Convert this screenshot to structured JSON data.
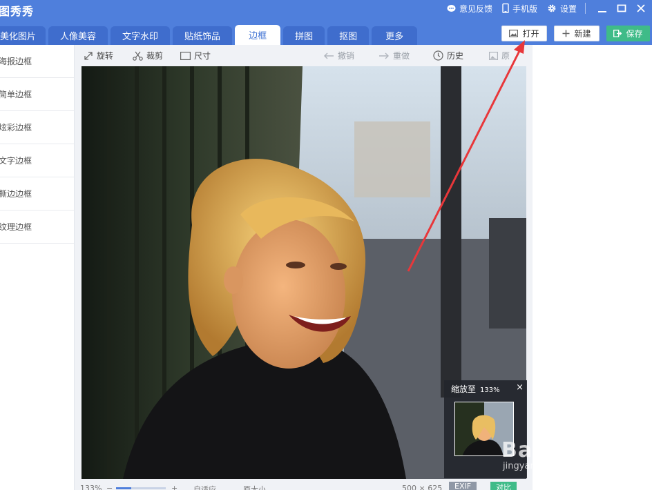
{
  "app": {
    "title": "图秀秀"
  },
  "top_links": {
    "feedback": "意见反馈",
    "mobile": "手机版",
    "settings": "设置"
  },
  "tabs": [
    {
      "label": "美化图片"
    },
    {
      "label": "人像美容"
    },
    {
      "label": "文字水印"
    },
    {
      "label": "贴纸饰品"
    },
    {
      "label": "边框",
      "active": true
    },
    {
      "label": "拼图"
    },
    {
      "label": "抠图"
    },
    {
      "label": "更多"
    }
  ],
  "actions": {
    "open": "打开",
    "new": "新建",
    "save": "保存"
  },
  "sidebar": {
    "items": [
      {
        "label": "海报边框"
      },
      {
        "label": "简单边框"
      },
      {
        "label": "炫彩边框"
      },
      {
        "label": "文字边框"
      },
      {
        "label": "撕边边框"
      },
      {
        "label": "纹理边框"
      }
    ]
  },
  "toolbar": {
    "rotate": "旋转",
    "crop": "裁剪",
    "size": "尺寸",
    "undo": "撤销",
    "redo": "重做",
    "history": "历史",
    "original": "原"
  },
  "zoom_popup": {
    "label": "缩放至",
    "percent": "133%",
    "close": "×"
  },
  "status": {
    "zoom": "133%",
    "fit": "自适应",
    "actual": "原大小",
    "dimensions": "500 × 625",
    "exif": "EXIF",
    "compare": "对比"
  },
  "watermark": {
    "brand": "Baidu经验",
    "url": "jingyan.baidu.com"
  },
  "colors": {
    "brand_blue": "#4f7fdc",
    "active_tab_text": "#3b6fd2",
    "save_green": "#3fbb88",
    "arrow_red": "#e8373a"
  }
}
